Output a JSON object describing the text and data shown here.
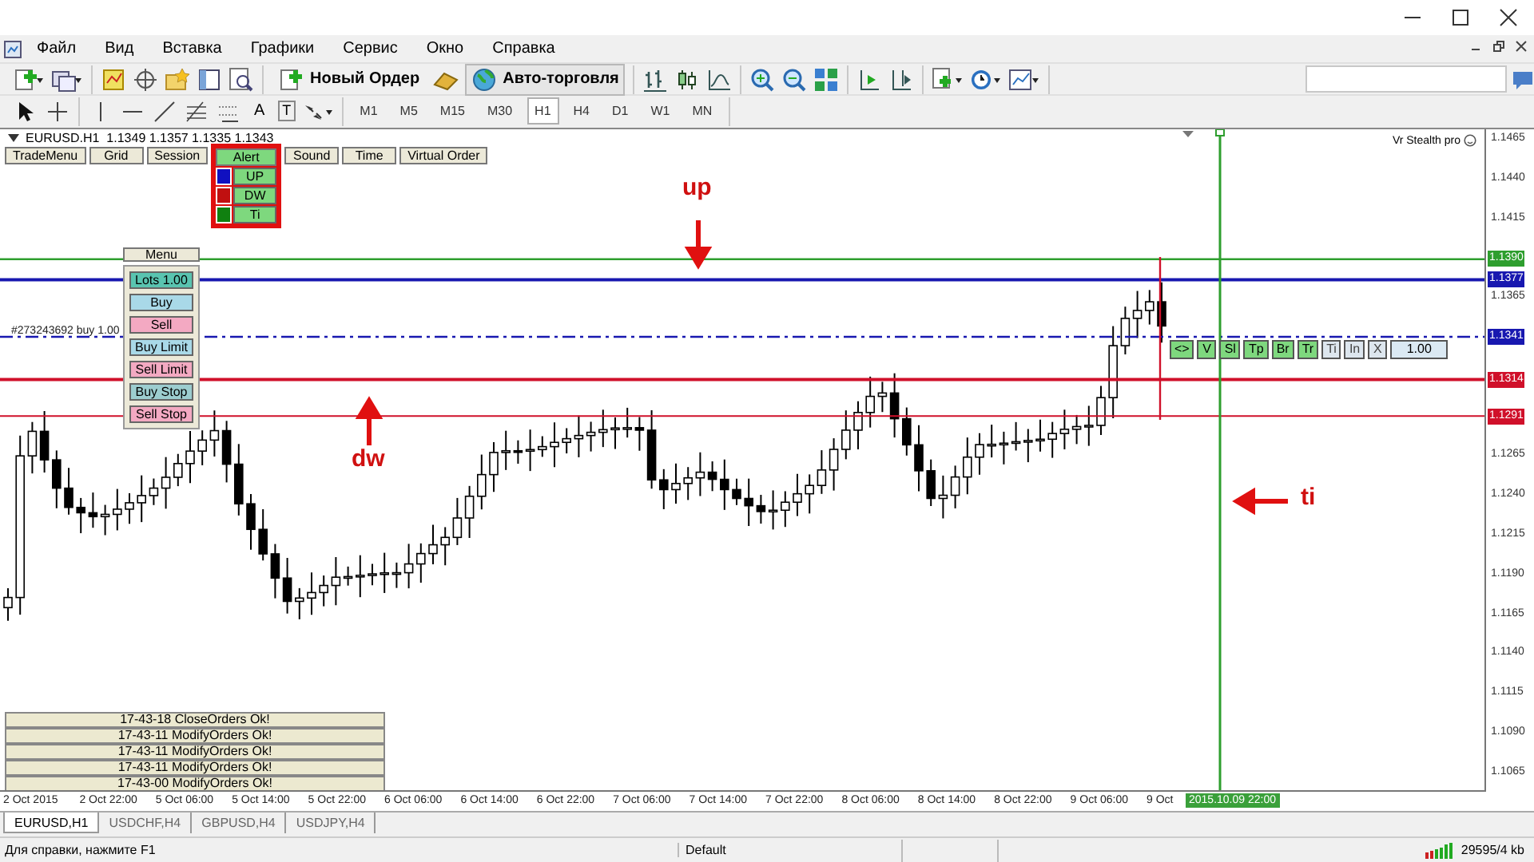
{
  "window": {
    "menu": [
      "Файл",
      "Вид",
      "Вставка",
      "Графики",
      "Сервис",
      "Окно",
      "Справка"
    ]
  },
  "toolbar": {
    "new_order": "Новый Ордер",
    "auto_trading": "Авто-торговля",
    "text_tool": "A",
    "label_tool": "T",
    "timeframes": [
      {
        "label": "M1",
        "selected": false
      },
      {
        "label": "M5",
        "selected": false
      },
      {
        "label": "M15",
        "selected": false
      },
      {
        "label": "M30",
        "selected": false
      },
      {
        "label": "H1",
        "selected": true
      },
      {
        "label": "H4",
        "selected": false
      },
      {
        "label": "D1",
        "selected": false
      },
      {
        "label": "W1",
        "selected": false
      },
      {
        "label": "MN",
        "selected": false
      }
    ]
  },
  "chart": {
    "header": "EURUSD.H1  1.1349 1.1357 1.1335 1.1343",
    "indicator": "Vr Stealth pro",
    "panel_tabs": [
      {
        "label": "TradeMenu",
        "selected": false
      },
      {
        "label": "Grid",
        "selected": false
      },
      {
        "label": "Session",
        "selected": false
      },
      {
        "label": "Alert",
        "selected": true
      },
      {
        "label": "Sound",
        "selected": false
      },
      {
        "label": "Time",
        "selected": false
      },
      {
        "label": "Virtual Order",
        "selected": false
      }
    ],
    "alerts": [
      {
        "label": "UP",
        "color": "#1010c0"
      },
      {
        "label": "DW",
        "color": "#c01010"
      },
      {
        "label": "Ti",
        "color": "#108010"
      }
    ],
    "menu": {
      "title": "Menu",
      "buttons": [
        {
          "label": "Lots 1.00",
          "kind": "lots"
        },
        {
          "label": "Buy",
          "kind": "buy"
        },
        {
          "label": "Sell",
          "kind": "sell"
        },
        {
          "label": "Buy Limit",
          "kind": "buy"
        },
        {
          "label": "Sell Limit",
          "kind": "sell"
        },
        {
          "label": "Buy Stop",
          "kind": "stop"
        },
        {
          "label": "Sell Stop",
          "kind": "sell"
        }
      ]
    },
    "order_label": "#273243692 buy 1.00",
    "order_buttons": [
      {
        "label": "<>",
        "enabled": true
      },
      {
        "label": "V",
        "enabled": true
      },
      {
        "label": "Sl",
        "enabled": true
      },
      {
        "label": "Tp",
        "enabled": true
      },
      {
        "label": "Br",
        "enabled": true
      },
      {
        "label": "Tr",
        "enabled": true
      },
      {
        "label": "Ti",
        "enabled": false
      },
      {
        "label": "In",
        "enabled": false
      },
      {
        "label": "X",
        "enabled": false
      }
    ],
    "order_lots": "1.00",
    "annotations": [
      {
        "label": "up",
        "kind": "down"
      },
      {
        "label": "dw",
        "kind": "up"
      },
      {
        "label": "ti",
        "kind": "left"
      }
    ],
    "levels": [
      {
        "label": "1.1390",
        "color": "#2e9e2e",
        "kind": "solid"
      },
      {
        "label": "1.1377",
        "color": "#1818b0",
        "kind": "solid"
      },
      {
        "label": "1.1341",
        "color": "#1818b0",
        "kind": "dashdot"
      },
      {
        "label": "1.1314",
        "color": "#d0102a",
        "kind": "solid"
      },
      {
        "label": "1.1291",
        "color": "#d0102a",
        "kind": "thin"
      }
    ],
    "price_scale": [
      "1.1465",
      "1.1440",
      "1.1415",
      "1.1365",
      "1.1265",
      "1.1240",
      "1.1215",
      "1.1190",
      "1.1165",
      "1.1140",
      "1.1115",
      "1.1090",
      "1.1065"
    ],
    "time_scale": [
      "2 Oct 2015",
      "2 Oct 22:00",
      "5 Oct 06:00",
      "5 Oct 14:00",
      "5 Oct 22:00",
      "6 Oct 06:00",
      "6 Oct 14:00",
      "6 Oct 22:00",
      "7 Oct 06:00",
      "7 Oct 14:00",
      "7 Oct 22:00",
      "8 Oct 06:00",
      "8 Oct 14:00",
      "8 Oct 22:00",
      "9 Oct 06:00",
      "9 Oct"
    ],
    "cursor_time": "2015.10.09 22:00",
    "log": [
      "17-43-18 CloseOrders Ok!",
      "17-43-11 ModifyOrders Ok!",
      "17-43-11 ModifyOrders Ok!",
      "17-43-11 ModifyOrders Ok!",
      "17-43-00 ModifyOrders Ok!"
    ]
  },
  "tabs": [
    {
      "label": "EURUSD,H1",
      "selected": true
    },
    {
      "label": "USDCHF,H4",
      "selected": false
    },
    {
      "label": "GBPUSD,H4",
      "selected": false
    },
    {
      "label": "USDJPY,H4",
      "selected": false
    }
  ],
  "status_bar": {
    "help": "Для справки, нажмите F1",
    "profile": "Default",
    "traffic": "29595/4 kb"
  }
}
